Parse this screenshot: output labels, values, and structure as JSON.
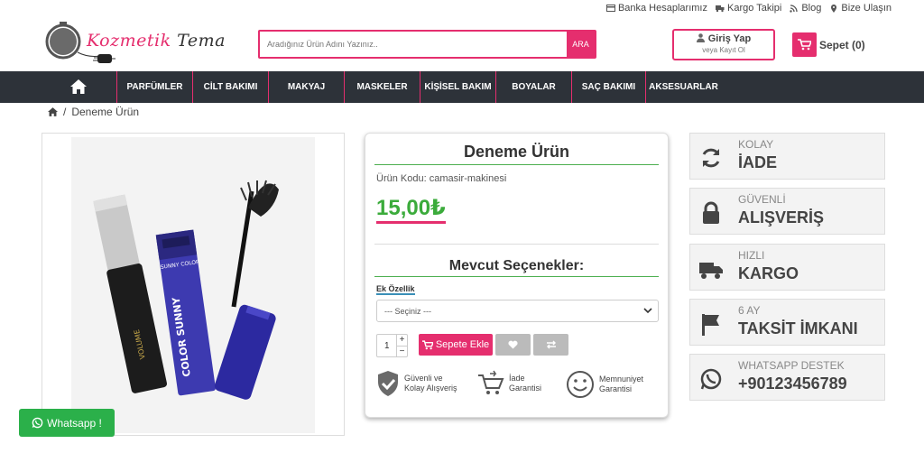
{
  "top_links": [
    {
      "label": "Banka Hesaplarımız",
      "icon": "bank-card-icon"
    },
    {
      "label": "Kargo Takipi",
      "icon": "truck-icon"
    },
    {
      "label": "Blog",
      "icon": "rss-icon"
    },
    {
      "label": "Bize Ulaşın",
      "icon": "map-marker-icon"
    }
  ],
  "logo": {
    "part1": "Kozmetik",
    "part2": "Tema"
  },
  "search": {
    "placeholder": "Aradığınız Ürün Adını Yazınız..",
    "button": "ARA"
  },
  "account": {
    "login": "Giriş Yap",
    "register": "veya Kayıt Ol"
  },
  "cart": {
    "label": "Sepet (0)"
  },
  "nav": [
    "PARFÜMLER",
    "CİLT BAKIMI",
    "MAKYAJ",
    "MASKELER",
    "KİŞİSEL BAKIM",
    "BOYALAR",
    "SAÇ BAKIMI",
    "AKSESUARLAR"
  ],
  "breadcrumb": {
    "current": "Deneme Ürün",
    "separator": "/"
  },
  "product": {
    "title": "Deneme Ürün",
    "code": "Ürün Kodu: camasir-makinesi",
    "price": "15,00₺",
    "options_title": "Mevcut Seçenekler:",
    "option_label": "Ek Özellik",
    "select_value": "--- Seçiniz ---",
    "qty": "1",
    "add_to_cart": "Sepete Ekle",
    "image_text_1": "COLOR SUNNY",
    "image_text_2": "SUNNY COLOR"
  },
  "features": [
    {
      "line1": "Güvenli ve",
      "line2": "Kolay Alışveriş"
    },
    {
      "line1": "İade",
      "line2": "Garantisi"
    },
    {
      "line1": "Memnuniyet",
      "line2": "Garantisi"
    }
  ],
  "side_boxes": [
    {
      "small": "KOLAY",
      "big": "İADE",
      "icon": "refresh-icon"
    },
    {
      "small": "GÜVENLİ",
      "big": "ALIŞVERİŞ",
      "icon": "lock-icon"
    },
    {
      "small": "HIZLI",
      "big": "KARGO",
      "icon": "truck-icon"
    },
    {
      "small": "6 AY",
      "big": "TAKSİT İMKANI",
      "icon": "flag-icon"
    },
    {
      "small": "WHATSAPP DESTEK",
      "big": "+90123456789",
      "icon": "whatsapp-icon"
    }
  ],
  "whatsapp": {
    "label": "Whatsapp !"
  },
  "colors": {
    "accent": "#e52e6e",
    "nav_bg": "#2d3239",
    "price": "#3bab3b",
    "whatsapp": "#2bb04a"
  }
}
